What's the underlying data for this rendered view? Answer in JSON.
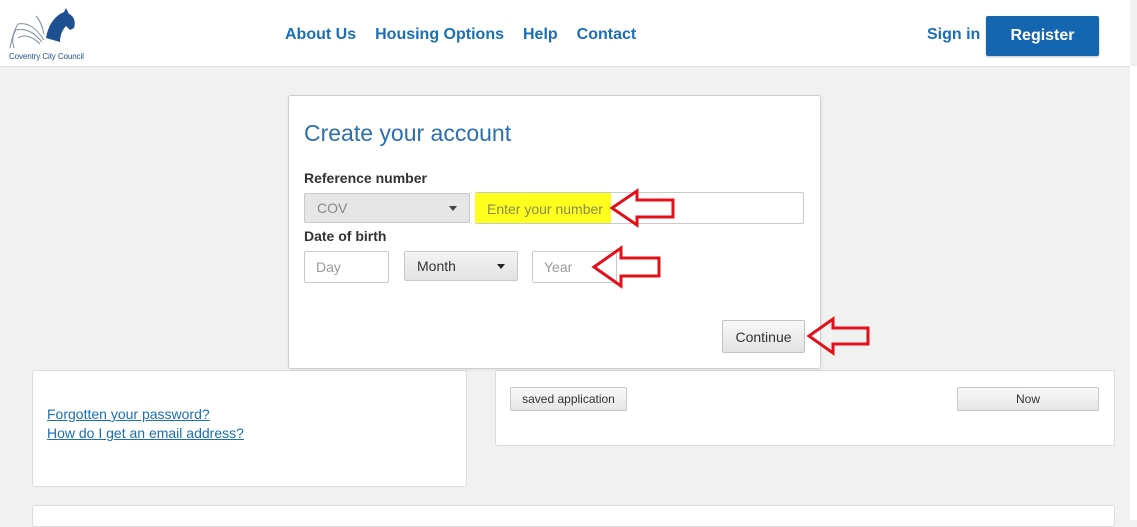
{
  "header": {
    "logo_text": "Coventry City Council",
    "nav": [
      "About Us",
      "Housing Options",
      "Help",
      "Contact"
    ],
    "sign_in": "Sign in",
    "register": "Register",
    "brand_color": "#1566b0"
  },
  "modal": {
    "title": "Create your account",
    "reference_label": "Reference number",
    "reference_prefix": "COV",
    "reference_placeholder": "Enter your number",
    "dob_label": "Date of birth",
    "day_placeholder": "Day",
    "month_value": "Month",
    "year_placeholder": "Year",
    "continue_label": "Continue",
    "highlight_color": "#ffff1e",
    "arrow_color": "#e3101a"
  },
  "left_panel": {
    "links": [
      "Forgotten your password?",
      "How do I get an email address?"
    ]
  },
  "right_panel": {
    "saved_button": "saved application",
    "now_button": "Now"
  }
}
